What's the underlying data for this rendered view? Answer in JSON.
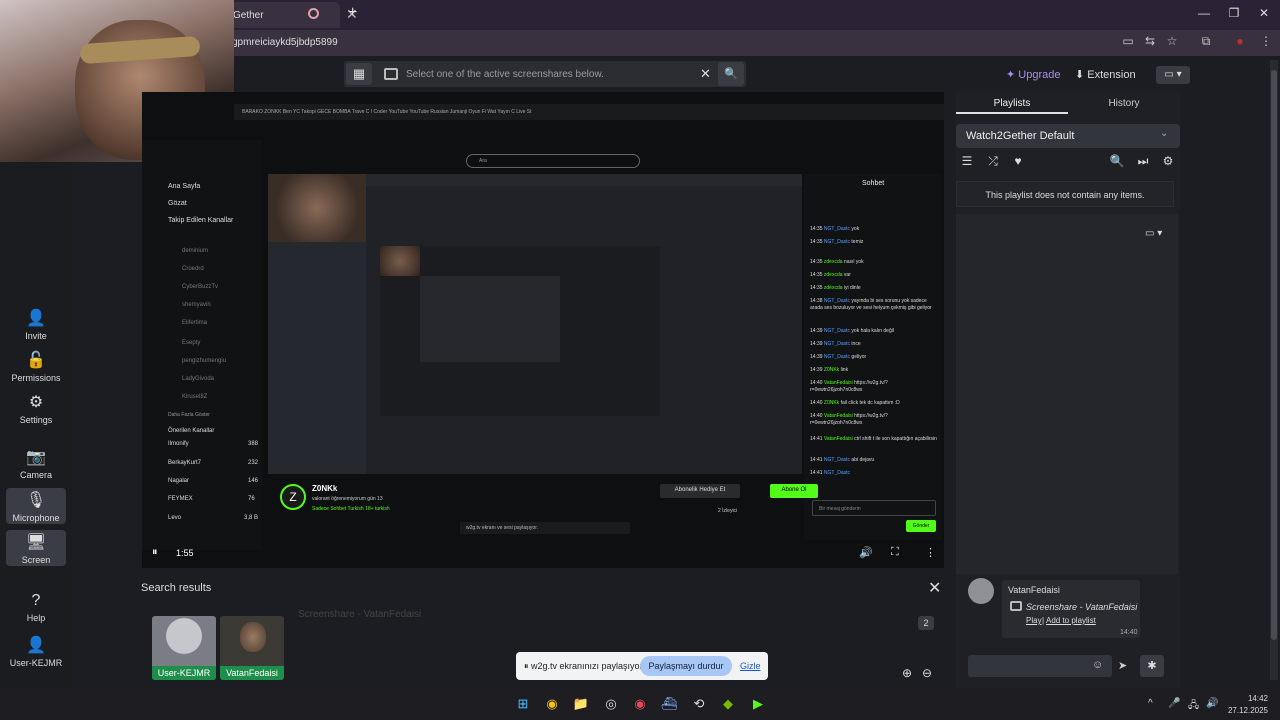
{
  "browser": {
    "tab_title": "Gether",
    "url": "gpmreiciaykd5jbdp5899",
    "new_tab": "+",
    "tab_close": "✕",
    "window": {
      "minimize": "—",
      "maximize": "❐",
      "close": "✕"
    }
  },
  "sidebar": {
    "items": [
      {
        "label": "Invite",
        "icon": "👤"
      },
      {
        "label": "Permissions",
        "icon": "🔓"
      },
      {
        "label": "Settings",
        "icon": "⚙"
      },
      {
        "label": "Camera",
        "icon": "📷"
      },
      {
        "label": "Microphone",
        "icon": "🎙"
      },
      {
        "label": "Screen",
        "icon": "🖥"
      },
      {
        "label": "Help",
        "icon": "?"
      },
      {
        "label": "User-KEJMR",
        "icon": "👤"
      }
    ]
  },
  "topbar": {
    "placeholder": "Select one of the active screenshares below.",
    "close": "✕",
    "search": "🔍",
    "grid": "▦",
    "upgrade": "Upgrade",
    "extension": "Extension",
    "dropdown": "▭ ▾"
  },
  "kick": {
    "nav": "BARAKO   ZONKK   Ben YC   Takopi   GECE   BOMBA   Trave C   I Coder   YouTube   YouTube   Russian   Jumanji   Oyun Fi   Wat   Yayın C   Live St",
    "search": "Ara",
    "sidebar": [
      "Ana Sayfa",
      "Gözat",
      "Takip Edilen Kanallar"
    ],
    "sidebar_dim": [
      "deminium",
      "Croedrd",
      "CyberBuzzTv",
      "shemyavin",
      "Elifertima",
      "Esepty",
      "pengizhumengiu",
      "LadyGivoda",
      "Kirusel8Z"
    ],
    "more": "Daha Fazla Göster",
    "recommended": "Önerilen Kanallar",
    "rec_channels": [
      {
        "name": "Ilmonify",
        "viewers": "388"
      },
      {
        "name": "BerkayKurt7",
        "viewers": "232"
      },
      {
        "name": "Nagalar",
        "viewers": "146"
      },
      {
        "name": "FEYMEX",
        "viewers": "76"
      },
      {
        "name": "Levo",
        "viewers": "3,8 B"
      }
    ],
    "chat_title": "Sohbet",
    "chat_lines": [
      {
        "t": "14:35",
        "u": "NGT_Dastc",
        "m": "yok"
      },
      {
        "t": "14:35",
        "u": "NGT_Dastc",
        "m": "temiz"
      },
      {
        "t": "14:35",
        "u": "zdexcda",
        "m": "nasıl yok"
      },
      {
        "t": "14:35",
        "u": "zdexcda",
        "m": "var"
      },
      {
        "t": "14:35",
        "u": "zdexcda",
        "m": "iyi dinle"
      },
      {
        "t": "14:38",
        "u": "NGT_Dastc",
        "m": "yayında bi ses sorunu yok sadece arada ses bozuluyor ve sesi helyum çekmiş gibi geliyor"
      },
      {
        "t": "14:39",
        "u": "NGT_Dastc",
        "m": "yok hala kalın değil"
      },
      {
        "t": "14:39",
        "u": "NGT_Dastc",
        "m": "ince"
      },
      {
        "t": "14:39",
        "u": "NGT_Dastc",
        "m": "geliyor"
      },
      {
        "t": "14:39",
        "u": "Z0NKk",
        "m": "link"
      },
      {
        "t": "14:40",
        "u": "VatanFedaisi",
        "m": "https://w2g.tv/?r=0ewtn26jzoh7n0c8wx"
      },
      {
        "t": "14:40",
        "u": "Z0NKk",
        "m": "fail click tek dc kapattım :D"
      },
      {
        "t": "14:40",
        "u": "VatanFedaisi",
        "m": "https://w2g.tv/?r=0ewtn26jzoh7n0c8wx"
      },
      {
        "t": "14:41",
        "u": "VatanFedaisi",
        "m": "ctrl shift t ile son kapattığın açabilirsin"
      },
      {
        "t": "14:41",
        "u": "NGT_Dastc",
        "m": "abi dejavu"
      },
      {
        "t": "14:41",
        "u": "NGT_Dastc",
        "m": ""
      }
    ],
    "streamer": "Z0NKk",
    "stream_title": "valorant öğrenemiyorum gün 13",
    "stream_tags": "Sadece Sohbet   Turkish   18+   turkish",
    "gift_btn": "Abonelik Hediye Et",
    "sub_btn": "Abone Ol",
    "viewers": "2 İzleyici",
    "chat_placeholder": "Bir mesaj gönderin",
    "send": "Gönder",
    "share_note": "w2g.tv ekranı ve sesi paylaşıyor."
  },
  "player": {
    "pause": "⏸",
    "time": "1:55",
    "volume": "🔊",
    "fullscreen": "⛶",
    "more": "⋮"
  },
  "search_results": {
    "title": "Search results",
    "close": "✕",
    "count": "2",
    "ghost": "Screenshare - VatanFedaisi",
    "users": [
      "User-KEJMR",
      "VatanFedaisi"
    ],
    "zoom_in": "⊕",
    "zoom_out": "⊖"
  },
  "share_notice": {
    "text": "⏸ w2g.tv ekranınızı paylaşıyor.",
    "stop": "Paylaşmayı durdur",
    "hide": "Gizle"
  },
  "right_panel": {
    "tabs": [
      "Playlists",
      "History"
    ],
    "playlist": "Watch2Gether Default",
    "empty": "This playlist does not contain any items.",
    "icons": [
      "☰",
      "⤮",
      "♥",
      "🔍",
      "⏭",
      "⚙"
    ],
    "dropdown": "▭ ▾",
    "message": {
      "user": "VatanFedaisi",
      "text": "Screenshare - VatanFedaisi",
      "play": "Play",
      "sep": "|",
      "add": "Add to playlist",
      "time": "14:40"
    },
    "emoji": "☺",
    "send": "➤",
    "gear": "✱"
  },
  "taskbar": {
    "icons": [
      "⊞",
      "◉",
      "📁",
      "◎",
      "◉",
      "⛴",
      "⟲",
      "◆",
      "▶"
    ],
    "time": "14:42",
    "date": "27.12.2025",
    "tray": [
      "^",
      "🎤",
      "🖧",
      "🔊"
    ]
  },
  "colors": {
    "accent_green": "#53fc18",
    "upgrade": "#a98cf0",
    "tile_label": "#1e8f4b"
  }
}
